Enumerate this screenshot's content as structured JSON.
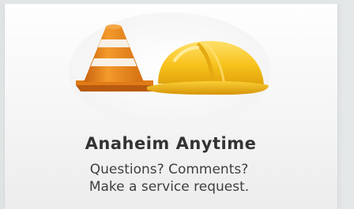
{
  "card": {
    "title": "Anaheim Anytime",
    "description_line1": "Questions? Comments?",
    "description_line2": "Make a service request.",
    "icon": "construction-cone-hardhat-icon"
  },
  "colors": {
    "page_background": "#dfe3e4",
    "title_text": "#333333",
    "body_text": "#3f3f3f",
    "cone_orange": "#f08a1c",
    "hardhat_yellow": "#f6c21a"
  }
}
